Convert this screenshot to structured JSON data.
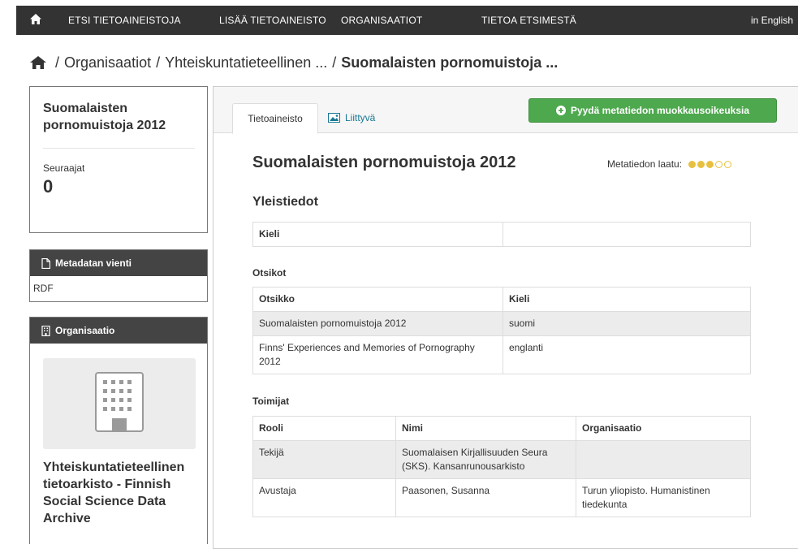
{
  "topbar": {
    "nav": [
      "ETSI TIETOAINEISTOJA",
      "LISÄÄ TIETOAINEISTO",
      "ORGANISAATIOT",
      "TIETOA ETSIMESTÄ"
    ],
    "lang": "in English"
  },
  "breadcrumb": {
    "sep": "/",
    "items": [
      "Organisaatiot",
      "Yhteiskuntatieteellinen ...",
      "Suomalaisten pornomuistoja ..."
    ]
  },
  "sidebar": {
    "dataset_title": "Suomalaisten pornomuistoja 2012",
    "followers_label": "Seuraajat",
    "followers_count": "0",
    "export_header": "Metadatan vienti",
    "export_items": [
      "RDF"
    ],
    "org_header": "Organisaatio",
    "org_name": "Yhteiskuntatieteellinen tietoarkisto - Finnish Social Science Data Archive"
  },
  "main": {
    "tabs": [
      "Tietoaineisto",
      "Liittyvä"
    ],
    "request_button": "Pyydä metatiedon muokkausoikeuksia",
    "title": "Suomalaisten pornomuistoja 2012",
    "quality_label": "Metatiedon laatu:",
    "quality_level": 3,
    "quality_max": 5,
    "section_general": "Yleistiedot",
    "language_row": {
      "label": "Kieli",
      "value": ""
    },
    "titles_heading": "Otsikot",
    "titles_table": {
      "headers": [
        "Otsikko",
        "Kieli"
      ],
      "rows": [
        [
          "Suomalaisten pornomuistoja 2012",
          "suomi"
        ],
        [
          "Finns' Experiences and Memories of Pornography 2012",
          "englanti"
        ]
      ]
    },
    "actors_heading": "Toimijat",
    "actors_table": {
      "headers": [
        "Rooli",
        "Nimi",
        "Organisaatio"
      ],
      "rows": [
        [
          "Tekijä",
          "Suomalaisen Kirjallisuuden Seura (SKS). Kansanrunousarkisto",
          ""
        ],
        [
          "Avustaja",
          "Paasonen, Susanna",
          "Turun yliopisto. Humanistinen tiedekunta"
        ]
      ]
    }
  },
  "colors": {
    "topbar": "#333333",
    "panel_header": "#444444",
    "button_green": "#4ea84e",
    "link_blue": "#187794",
    "quality_gold": "#e8c040"
  },
  "icons": {
    "home": "home-icon",
    "document": "document-icon",
    "building": "building-icon",
    "image": "image-icon",
    "plus": "plus-circle-icon"
  }
}
